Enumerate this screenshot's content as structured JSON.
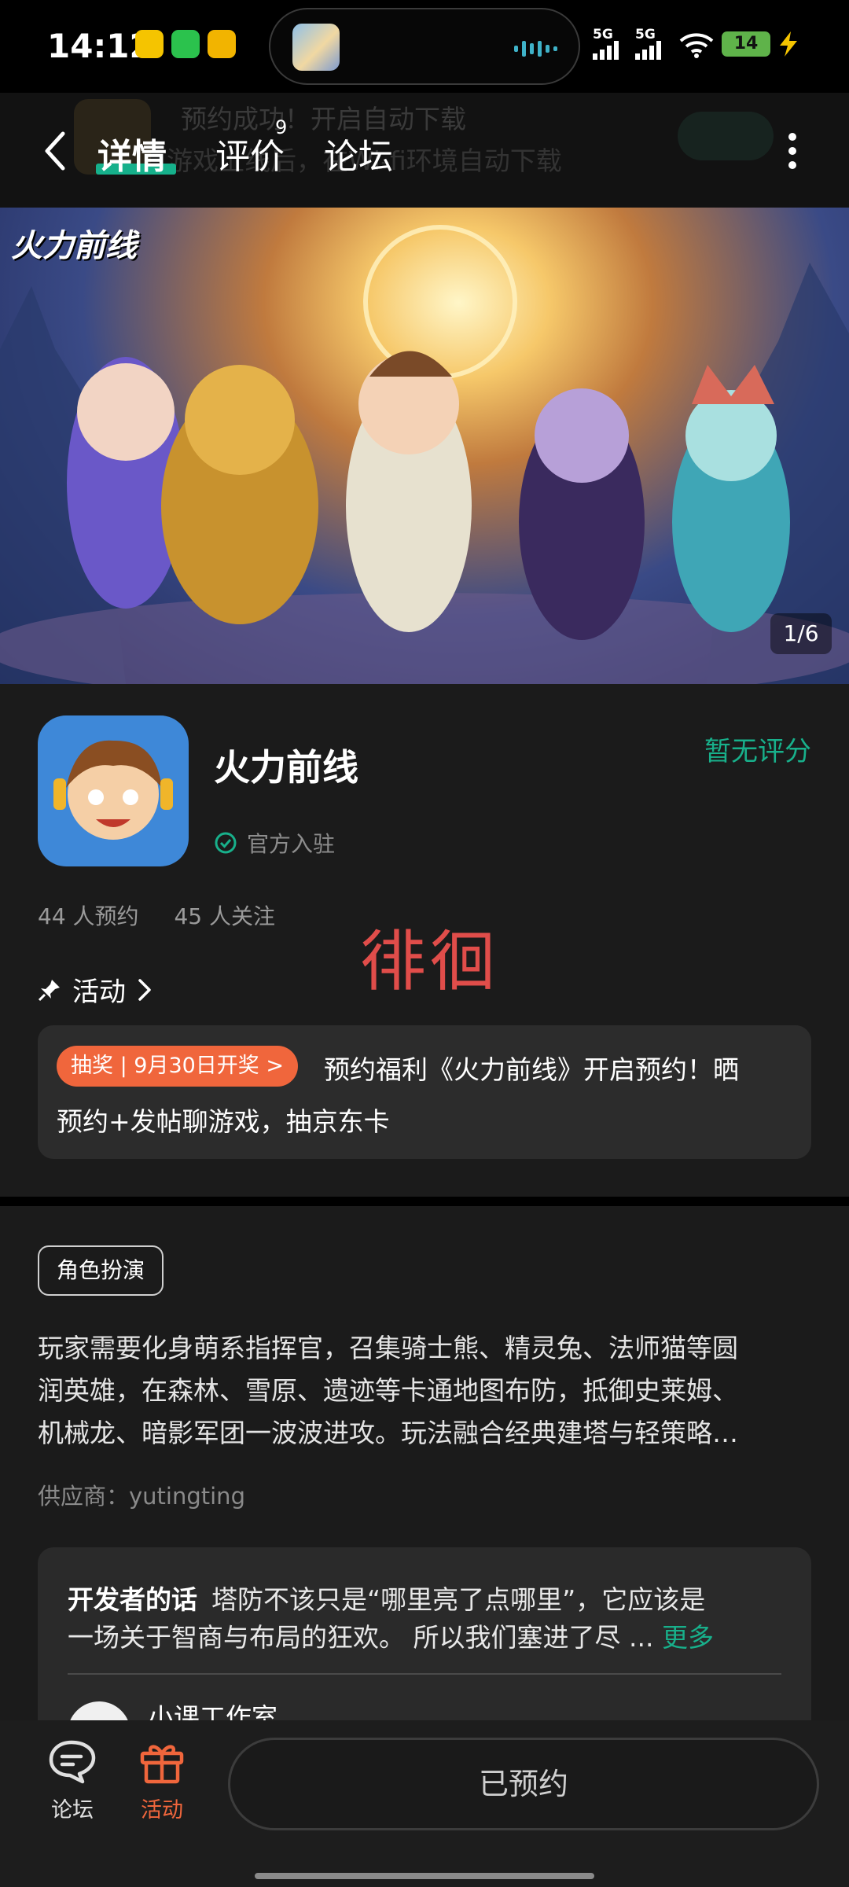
{
  "status_bar": {
    "time": "14:12",
    "signal_1": "5G",
    "signal_2": "5G",
    "battery": "14"
  },
  "background_notice": {
    "title": "预约成功！开启自动下载",
    "subtitle": "游戏上线后，在Wi-fi环境自动下载"
  },
  "nav": {
    "tabs": [
      {
        "label": "详情",
        "active": true
      },
      {
        "label": "评价",
        "badge": "9"
      },
      {
        "label": "论坛"
      }
    ]
  },
  "banner": {
    "logo_text": "火力前线",
    "page_indicator": "1/6"
  },
  "game": {
    "name": "火力前线",
    "verified_label": "官方入驻",
    "rating_text": "暂无评分",
    "reservations": "44 人预约",
    "followers": "45 人关注",
    "watermark": "徘徊"
  },
  "activity": {
    "header": "活动",
    "tag": "抽奖 | 9月30日开奖 >",
    "line1": "预约福利《火力前线》开启预约！晒",
    "line2": "预约+发帖聊游戏，抽京东卡"
  },
  "details": {
    "genre": "角色扮演",
    "description_lines": [
      "玩家需要化身萌系指挥官，召集骑士熊、精灵兔、法师猫等圆",
      "润英雄，在森林、雪原、遗迹等卡通地图布防，抵御史莱姆、",
      "机械龙、暗影军团一波波进攻。玩法融合经典建塔与轻策略…"
    ],
    "supplier": "供应商：yutingting"
  },
  "developer": {
    "label": "开发者的话",
    "line1": "塔防不该只是“哪里亮了点哪里”，它应该是",
    "line2": "一场关于智商与布局的狂欢。 所以我们塞进了尽 ... ",
    "more": "更多",
    "studio": "小课工作室"
  },
  "bottom_bar": {
    "forum_label": "论坛",
    "activity_label": "活动",
    "reserved_button": "已预约"
  },
  "colors": {
    "accent_green": "#18b08b",
    "lottery_orange": "#f0663c",
    "activity_icon_orange": "#f0663c",
    "watermark_red": "#e04d4a"
  }
}
